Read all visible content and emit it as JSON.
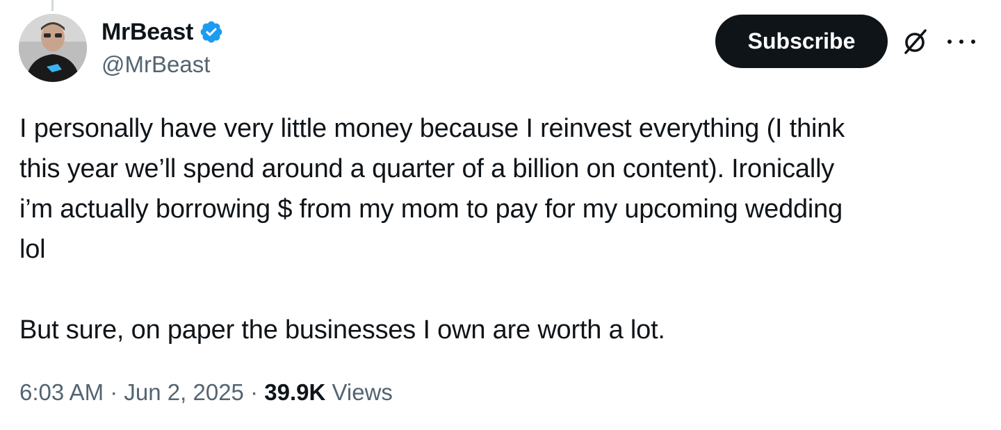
{
  "author": {
    "display_name": "MrBeast",
    "handle": "@MrBeast",
    "verified": true,
    "verified_icon": "verified-badge-icon",
    "verified_color": "#1d9bf0"
  },
  "actions": {
    "subscribe_label": "Subscribe",
    "grok_icon": "grok-icon",
    "more_icon": "more-options-icon"
  },
  "tweet": {
    "lines": [
      "I personally have very little money because I reinvest everything (I think",
      "this year we’ll spend around a quarter of a billion on content). Ironically",
      "i’m actually borrowing $ from my mom to pay for my upcoming wedding",
      "lol"
    ],
    "second_paragraph": "But sure, on paper the businesses I own are worth a lot."
  },
  "meta": {
    "time": "6:03 AM",
    "separator": "·",
    "date": "Jun 2, 2025",
    "views_count": "39.9K",
    "views_label": "Views"
  },
  "colors": {
    "text_primary": "#0f1419",
    "text_secondary": "#536471",
    "button_bg": "#0f1419",
    "button_text": "#ffffff"
  }
}
